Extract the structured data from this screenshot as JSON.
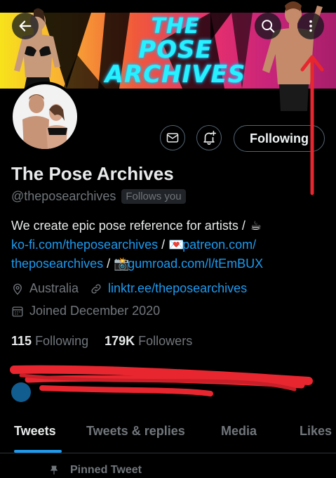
{
  "banner": {
    "title_line1": "THE",
    "title_line2": "POSE ARCHIVES",
    "colors": {
      "accent": "#27f0ff",
      "gradient_start": "#f7e21b",
      "gradient_end": "#a81e6b"
    }
  },
  "header": {
    "back_icon": "arrow-left-icon",
    "search_icon": "search-icon",
    "more_icon": "more-vertical-icon"
  },
  "profile": {
    "name": "The Pose Archives",
    "handle": "@theposearchives",
    "follows_you": "Follows you",
    "bio": {
      "line1_text": "We create epic pose reference for artists / ",
      "line1_emoji": "☕",
      "line2_link1": "ko-fi.com/theposearchives",
      "line2_sep": " / ",
      "line2_emoji": "💌",
      "line2_link2": "patreon.com/",
      "line3_link2_cont": "theposearchives",
      "line3_sep": " / ",
      "line3_emoji": "📸",
      "line3_link3": "gumroad.com/l/tEmBUX"
    },
    "location": "Australia",
    "website": "linktr.ee/theposearchives",
    "joined": "Joined December 2020",
    "following_count": "115",
    "following_label": "Following",
    "followers_count": "179K",
    "followers_label": "Followers"
  },
  "actions": {
    "message_icon": "mail-icon",
    "notify_icon": "bell-plus-icon",
    "following_button": "Following"
  },
  "tabs": [
    {
      "label": "Tweets",
      "active": true
    },
    {
      "label": "Tweets & replies",
      "active": false
    },
    {
      "label": "Media",
      "active": false
    },
    {
      "label": "Likes",
      "active": false
    }
  ],
  "pinned": {
    "label": "Pinned Tweet",
    "icon": "pin-icon"
  },
  "colors": {
    "link": "#1d9bf0",
    "muted": "#71767b",
    "annotation": "#e8262f"
  }
}
